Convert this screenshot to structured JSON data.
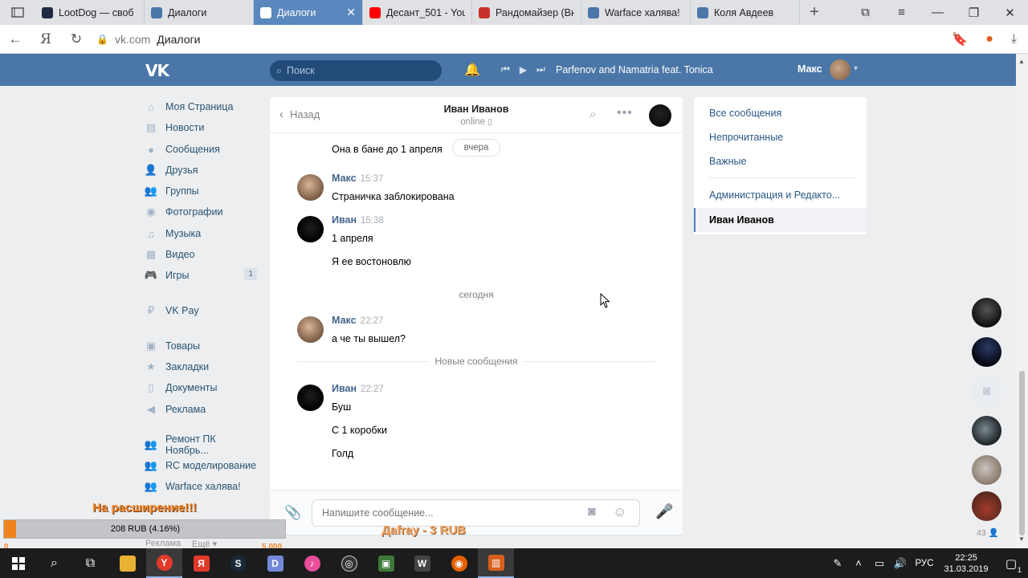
{
  "browser": {
    "tabs": [
      {
        "title": "LootDog — своб",
        "icon_color": "#1f2a44",
        "icon": "lootdog-icon"
      },
      {
        "title": "Диалоги",
        "icon_color": "#4a76a8",
        "icon": "vk-messages-icon"
      },
      {
        "title": "Диалоги",
        "icon_color": "#ffffff",
        "icon": "vk-messages-icon",
        "active": true
      },
      {
        "title": "Десант_501 - You",
        "icon_color": "#ff0000",
        "icon": "youtube-icon"
      },
      {
        "title": "Рандомайзер (Вн",
        "icon_color": "#c9302c",
        "icon": "randomizer-icon"
      },
      {
        "title": "Warface халява!",
        "icon_color": "#4a76a8",
        "icon": "vk-icon"
      },
      {
        "title": "Коля Авдеев",
        "icon_color": "#4a76a8",
        "icon": "vk-icon"
      }
    ],
    "address": {
      "host": "vk.com",
      "page_title": "Диалоги"
    }
  },
  "vk_header": {
    "logo": "VK",
    "search_placeholder": "Поиск",
    "now_playing": "Parfenov and Namatria feat. Tonica ...",
    "user_name": "Макс"
  },
  "left_menu": {
    "items": [
      {
        "label": "Моя Страница",
        "icon": "home-icon",
        "glyph": "⌂"
      },
      {
        "label": "Новости",
        "icon": "news-icon",
        "glyph": "▤"
      },
      {
        "label": "Сообщения",
        "icon": "messages-icon",
        "glyph": "●"
      },
      {
        "label": "Друзья",
        "icon": "friends-icon",
        "glyph": "👤"
      },
      {
        "label": "Группы",
        "icon": "groups-icon",
        "glyph": "👥"
      },
      {
        "label": "Фотографии",
        "icon": "camera-icon",
        "glyph": "◉"
      },
      {
        "label": "Музыка",
        "icon": "music-icon",
        "glyph": "♫"
      },
      {
        "label": "Видео",
        "icon": "video-icon",
        "glyph": "▦"
      },
      {
        "label": "Игры",
        "icon": "games-icon",
        "glyph": "🎮",
        "badge": "1"
      },
      {
        "label": "VK Pay",
        "icon": "vkpay-icon",
        "glyph": "₽"
      },
      {
        "label": "Товары",
        "icon": "goods-icon",
        "glyph": "▣"
      },
      {
        "label": "Закладки",
        "icon": "bookmark-star-icon",
        "glyph": "★"
      },
      {
        "label": "Документы",
        "icon": "documents-icon",
        "glyph": "▯"
      },
      {
        "label": "Реклама",
        "icon": "ads-megaphone-icon",
        "glyph": "◀"
      },
      {
        "label": "Ремонт ПК Ноябрь...",
        "icon": "group-icon",
        "glyph": "👥"
      },
      {
        "label": "RC моделирование",
        "icon": "group-icon",
        "glyph": "👥"
      },
      {
        "label": "Warface халява!",
        "icon": "group-icon",
        "glyph": "👥"
      }
    ],
    "footer": {
      "ads": "Реклама",
      "more": "Ещё"
    }
  },
  "chat": {
    "back_label": "Назад",
    "peer_name": "Иван Иванов",
    "peer_status": "online",
    "date_pill": "вчера",
    "first_line": "Она в бане до 1 апреля",
    "groups": [
      {
        "author": "Макс",
        "time": "15:37",
        "lines": [
          "Страничка заблокирована"
        ]
      },
      {
        "author": "Иван",
        "time": "15:38",
        "lines": [
          "1 апреля",
          "Я ее востоновлю"
        ]
      },
      {
        "author": "Макс",
        "time": "22:27",
        "lines": [
          "а че ты вышел?"
        ]
      },
      {
        "author": "Иван",
        "time": "22:27",
        "lines": [
          "Буш",
          "С 1 коробки",
          "Голд"
        ]
      }
    ],
    "day_today": "сегодня",
    "new_messages": "Новые сообщения",
    "composer_placeholder": "Напишите сообщение..."
  },
  "filters": {
    "items": [
      "Все сообщения",
      "Непрочитанные",
      "Важные",
      "Администрация и Редакто..."
    ],
    "active": "Иван Иванов"
  },
  "friends_rail": {
    "count": "43"
  },
  "stream_overlay": {
    "headline": "На расширение!!!",
    "progress_text": "208 RUB (4.16%)",
    "progress_fraction": 0.0416,
    "min": "0",
    "max": "5 000",
    "last_donor": "Дafray - 3 RUB"
  },
  "taskbar": {
    "lang": "РУС",
    "time": "22:25",
    "date": "31.03.2019",
    "notifications": "1"
  }
}
